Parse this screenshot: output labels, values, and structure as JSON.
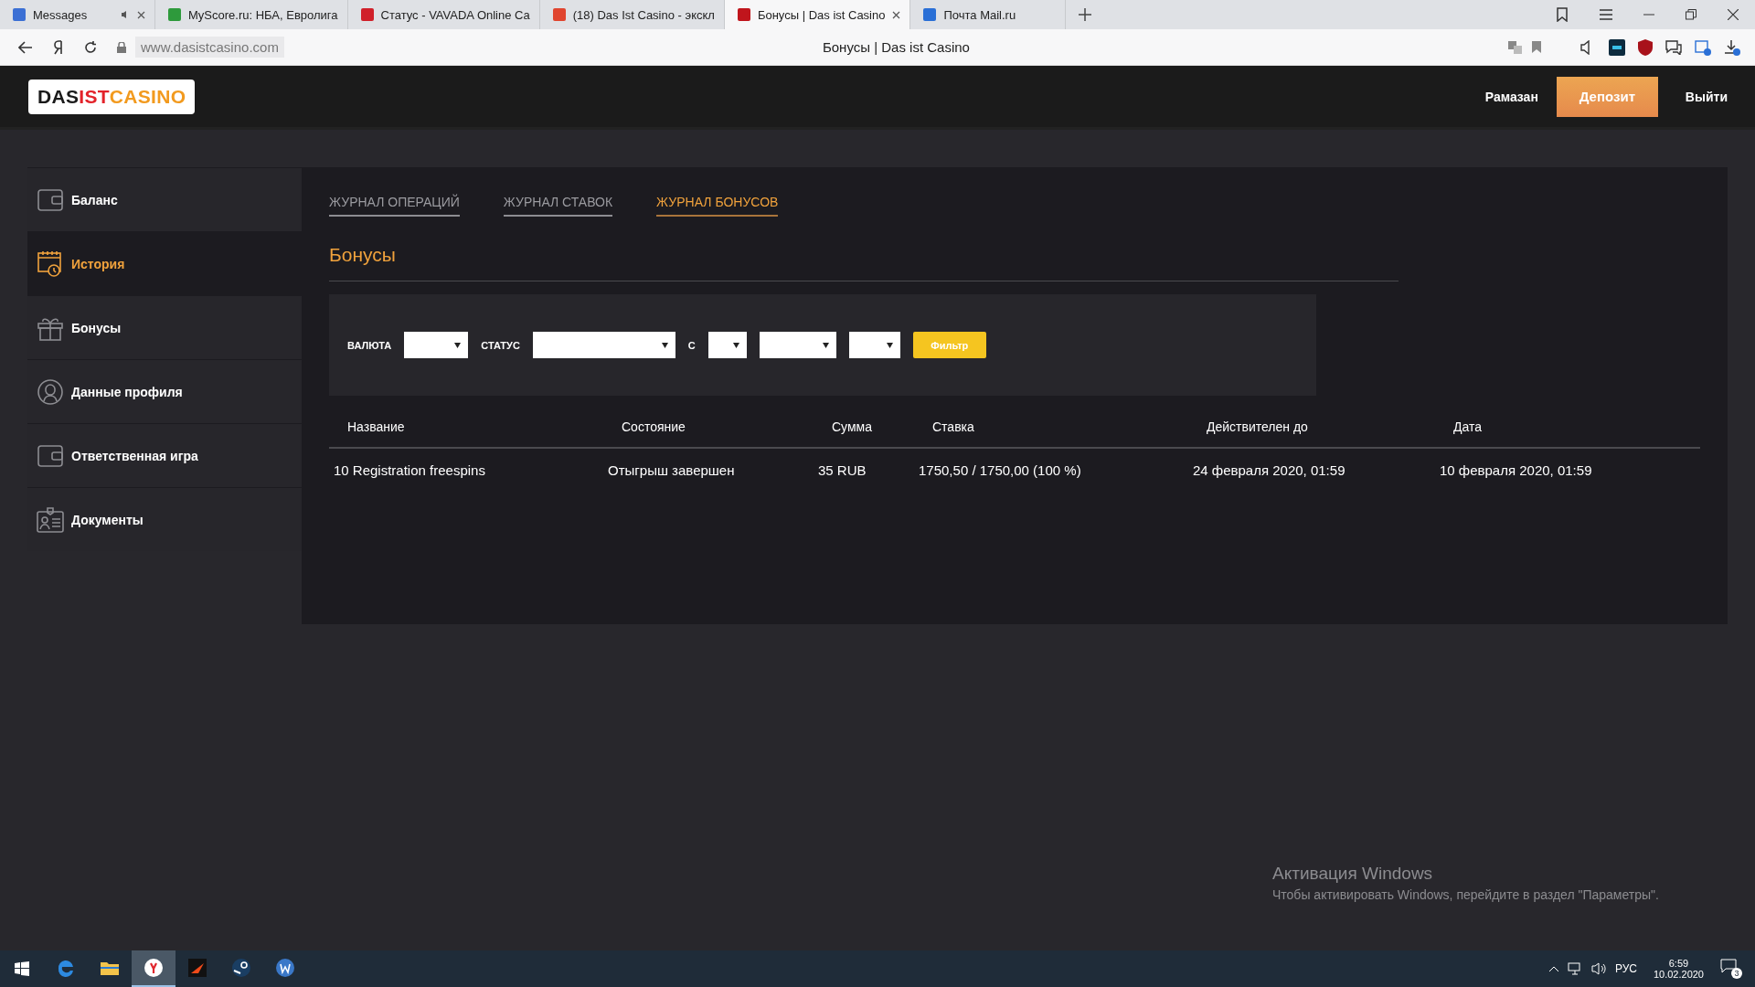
{
  "browser": {
    "tabs": [
      {
        "title": "Messages",
        "selected": false,
        "color": "#3b6fd4",
        "muted": true,
        "closable": true
      },
      {
        "title": "MyScore.ru: НБА, Евролига",
        "selected": false,
        "color": "#2e9a3c",
        "muted": false,
        "closable": false
      },
      {
        "title": "Статус - VAVADA Online Ca",
        "selected": false,
        "color": "#d0202a",
        "muted": false,
        "closable": false
      },
      {
        "title": "(18) Das Ist Casino - экскл",
        "selected": false,
        "color": "#e0452f",
        "muted": false,
        "closable": false
      },
      {
        "title": "Бонусы | Das ist Casino",
        "selected": true,
        "color": "#c0151c",
        "muted": false,
        "closable": true
      },
      {
        "title": "Почта Mail.ru",
        "selected": false,
        "color": "#2a6fd6",
        "muted": false,
        "closable": false
      }
    ],
    "url": "www.dasistcasino.com",
    "page_title": "Бонусы | Das ist Casino"
  },
  "header": {
    "logo": [
      {
        "text": "DAS",
        "color": "#1a1a1a"
      },
      {
        "text": "IST",
        "color": "#e3232a"
      },
      {
        "text": "CASINO",
        "color": "#f29a1e"
      }
    ],
    "user": "Рамазан",
    "deposit": "Депозит",
    "logout": "Выйти"
  },
  "sidebar": {
    "items": [
      {
        "label": "Баланс",
        "selected": false,
        "kind": "wallet"
      },
      {
        "label": "История",
        "selected": true,
        "kind": "calendar"
      },
      {
        "label": "Бонусы",
        "selected": false,
        "kind": "gift"
      },
      {
        "label": "Данные профиля",
        "selected": false,
        "kind": "user"
      },
      {
        "label": "Ответственная игра",
        "selected": false,
        "kind": "wallet"
      },
      {
        "label": "Документы",
        "selected": false,
        "kind": "badge"
      }
    ]
  },
  "tabs": [
    {
      "label": "ЖУРНАЛ ОПЕРАЦИЙ",
      "selected": false
    },
    {
      "label": "ЖУРНАЛ СТАВОК",
      "selected": false
    },
    {
      "label": "ЖУРНАЛ БОНУСОВ",
      "selected": true
    }
  ],
  "heading": "Бонусы",
  "filters": [
    {
      "kind": "label",
      "text": "ВАЛЮТА"
    },
    {
      "kind": "select"
    },
    {
      "kind": "label",
      "text": "СТАТУС"
    },
    {
      "kind": "select"
    },
    {
      "kind": "label",
      "text": "С"
    },
    {
      "kind": "select"
    },
    {
      "kind": "select"
    },
    {
      "kind": "select"
    },
    {
      "kind": "button",
      "text": "Фильтр"
    }
  ],
  "table": {
    "columns": [
      "Название",
      "Состояние",
      "Сумма",
      "Ставка",
      "Действителен до",
      "Дата"
    ],
    "rows": [
      [
        "10 Registration freespins",
        "Отыгрыш завершен",
        "35 RUB",
        "1750,50 / 1750,00 (100 %)",
        "24 февраля 2020, 01:59",
        "10 февраля 2020, 01:59"
      ]
    ]
  },
  "os_notice": {
    "title": "Активация Windows",
    "text": "Чтобы активировать Windows, перейдите в раздел \"Параметры\"."
  },
  "taskbar": {
    "apps": [
      {
        "kind": "edge",
        "selected": false
      },
      {
        "kind": "folder",
        "selected": false
      },
      {
        "kind": "yandex",
        "selected": true
      },
      {
        "kind": "app",
        "selected": false
      },
      {
        "kind": "steam",
        "selected": false
      },
      {
        "kind": "w",
        "selected": false
      }
    ],
    "language": "РУС",
    "time": "6:59",
    "date": "10.02.2020",
    "notifications": "3"
  }
}
